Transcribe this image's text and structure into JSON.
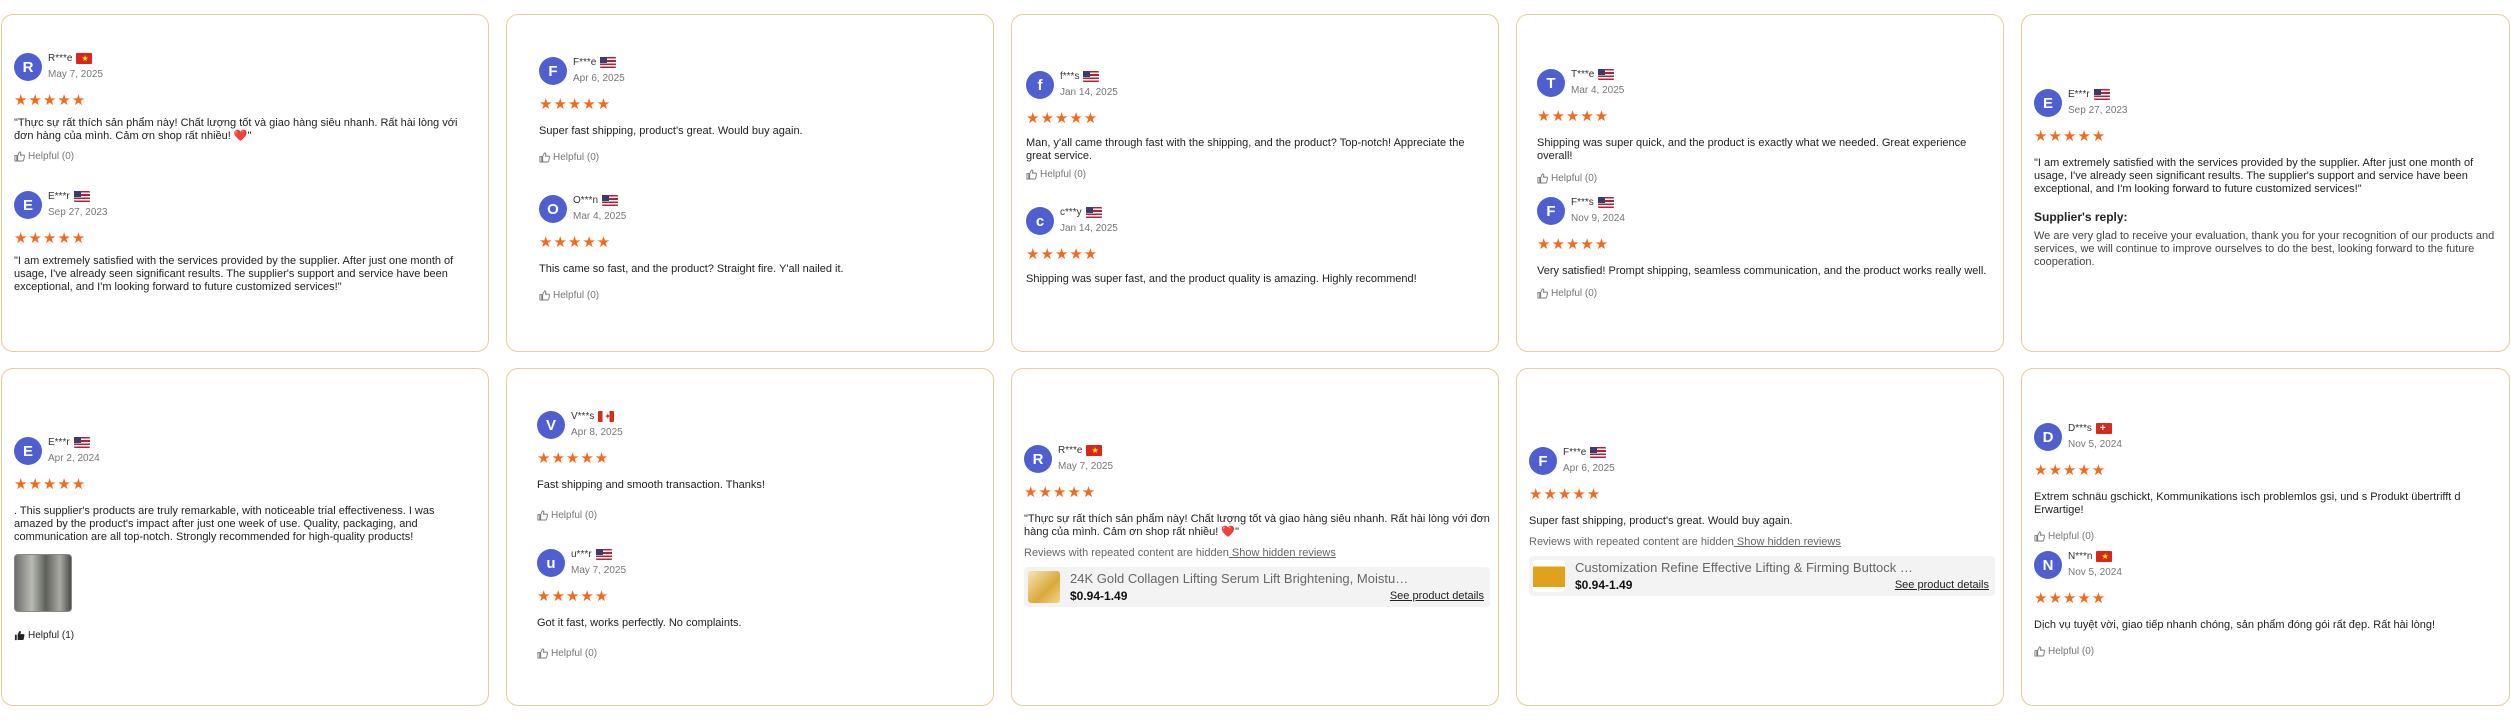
{
  "cards": [
    {
      "reviews": [
        {
          "initial": "R",
          "name": "R***e",
          "flag": "vn",
          "date": "May 7, 2025",
          "stars": "★★★★★",
          "text": "\"Thực sự rất thích sản phẩm này! Chất lượng tốt và giao hàng siêu nhanh. Rất hài lòng với đơn hàng của mình. Cảm ơn shop rất nhiều! ❤️\"",
          "helpful": "Helpful (0)"
        },
        {
          "initial": "E",
          "name": "E***r",
          "flag": "us",
          "date": "Sep 27, 2023",
          "stars": "★★★★★",
          "text": "\"I am extremely satisfied with the services provided by the supplier. After just one month of usage, I've already seen significant results. The supplier's support and service have been exceptional, and I'm looking forward to future customized services!\""
        }
      ]
    },
    {
      "reviews": [
        {
          "initial": "F",
          "name": "F***e",
          "flag": "us",
          "date": "Apr 6, 2025",
          "stars": "★★★★★",
          "text": "Super fast shipping, product's great. Would buy again.",
          "helpful": "Helpful (0)"
        },
        {
          "initial": "O",
          "name": "O***n",
          "flag": "us",
          "date": "Mar 4, 2025",
          "stars": "★★★★★",
          "text": "This came so fast, and the product? Straight fire. Y'all nailed it.",
          "helpful": "Helpful (0)"
        }
      ]
    },
    {
      "reviews": [
        {
          "initial": "f",
          "name": "f***s",
          "flag": "us",
          "date": "Jan 14, 2025",
          "stars": "★★★★★",
          "text": "Man, y'all came through fast with the shipping, and the product? Top-notch! Appreciate the great service.",
          "helpful": "Helpful (0)"
        },
        {
          "initial": "c",
          "name": "c***y",
          "flag": "us",
          "date": "Jan 14, 2025",
          "stars": "★★★★★",
          "text": "Shipping was super fast, and the product quality is amazing. Highly recommend!"
        }
      ]
    },
    {
      "reviews": [
        {
          "initial": "T",
          "name": "T***e",
          "flag": "us",
          "date": "Mar 4, 2025",
          "stars": "★★★★★",
          "text": "Shipping was super quick, and the product is exactly what we needed. Great experience overall!",
          "helpful": "Helpful (0)"
        },
        {
          "initial": "F",
          "name": "F***s",
          "flag": "us",
          "date": "Nov 9, 2024",
          "stars": "★★★★★",
          "text": "Very satisfied! Prompt shipping, seamless communication, and the product works really well.",
          "helpful": "Helpful (0)"
        }
      ]
    },
    {
      "reviews": [
        {
          "initial": "E",
          "name": "E***r",
          "flag": "us",
          "date": "Sep 27, 2023",
          "stars": "★★★★★",
          "text": "\"I am extremely satisfied with the services provided by the supplier. After just one month of usage, I've already seen significant results. The supplier's support and service have been exceptional, and I'm looking forward to future customized services!\"",
          "reply_title": "Supplier's reply:",
          "reply_text": "We are very glad to receive your evaluation, thank you for your recognition of our products and services, we will continue to improve ourselves to do the best, looking forward to the future cooperation."
        }
      ]
    },
    {
      "reviews": [
        {
          "initial": "E",
          "name": "E***r",
          "flag": "us",
          "date": "Apr 2, 2024",
          "stars": "★★★★★",
          "text": ". This supplier's products are truly remarkable, with noticeable trial effectiveness. I was amazed by the product's impact after just one week of use. Quality, packaging, and communication are all top-notch. Strongly recommended for high-quality products!",
          "helpful": "Helpful (1)"
        }
      ]
    },
    {
      "reviews": [
        {
          "initial": "V",
          "name": "V***s",
          "flag": "ca",
          "date": "Apr 8, 2025",
          "stars": "★★★★★",
          "text": "Fast shipping and smooth transaction. Thanks!",
          "helpful": "Helpful (0)"
        },
        {
          "initial": "u",
          "name": "u***r",
          "flag": "us",
          "date": "May 7, 2025",
          "stars": "★★★★★",
          "text": "Got it fast, works perfectly. No complaints.",
          "helpful": "Helpful (0)"
        }
      ]
    },
    {
      "reviews": [
        {
          "initial": "R",
          "name": "R***e",
          "flag": "vn",
          "date": "May 7, 2025",
          "stars": "★★★★★",
          "text": "\"Thực sự rất thích sản phẩm này! Chất lượng tốt và giao hàng siêu nhanh. Rất hài lòng với đơn hàng của mình. Cảm ơn shop rất nhiều! ❤️\"",
          "hidden_text": "Reviews with repeated content are hidden",
          "hidden_link": " Show hidden reviews",
          "product_title": "24K Gold Collagen Lifting Serum Lift Brightening, Moisturi...",
          "product_price": "$0.94-1.49",
          "product_link": "See product details"
        }
      ]
    },
    {
      "reviews": [
        {
          "initial": "F",
          "name": "F***e",
          "flag": "us",
          "date": "Apr 6, 2025",
          "stars": "★★★★★",
          "text": "Super fast shipping, product's great. Would buy again.",
          "hidden_text": "Reviews with repeated content are hidden",
          "hidden_link": " Show hidden reviews",
          "product_title": "Customization Refine Effective Lifting & Firming Buttock E...",
          "product_price": "$0.94-1.49",
          "product_link": "See product details"
        }
      ]
    },
    {
      "reviews": [
        {
          "initial": "D",
          "name": "D***s",
          "flag": "ch",
          "date": "Nov 5, 2024",
          "stars": "★★★★★",
          "text": "Extrem schnäu gschickt, Kommunikations isch problemlos gsi, und s Produkt übertrifft d Erwartige!",
          "helpful": "Helpful (0)"
        },
        {
          "initial": "N",
          "name": "N***n",
          "flag": "vn",
          "date": "Nov 5, 2024",
          "stars": "★★★★★",
          "text": "Dịch vụ tuyệt vời, giao tiếp nhanh chóng, sản phẩm đóng gói rất đẹp. Rất hài lòng!",
          "helpful": "Helpful (0)"
        }
      ]
    }
  ]
}
